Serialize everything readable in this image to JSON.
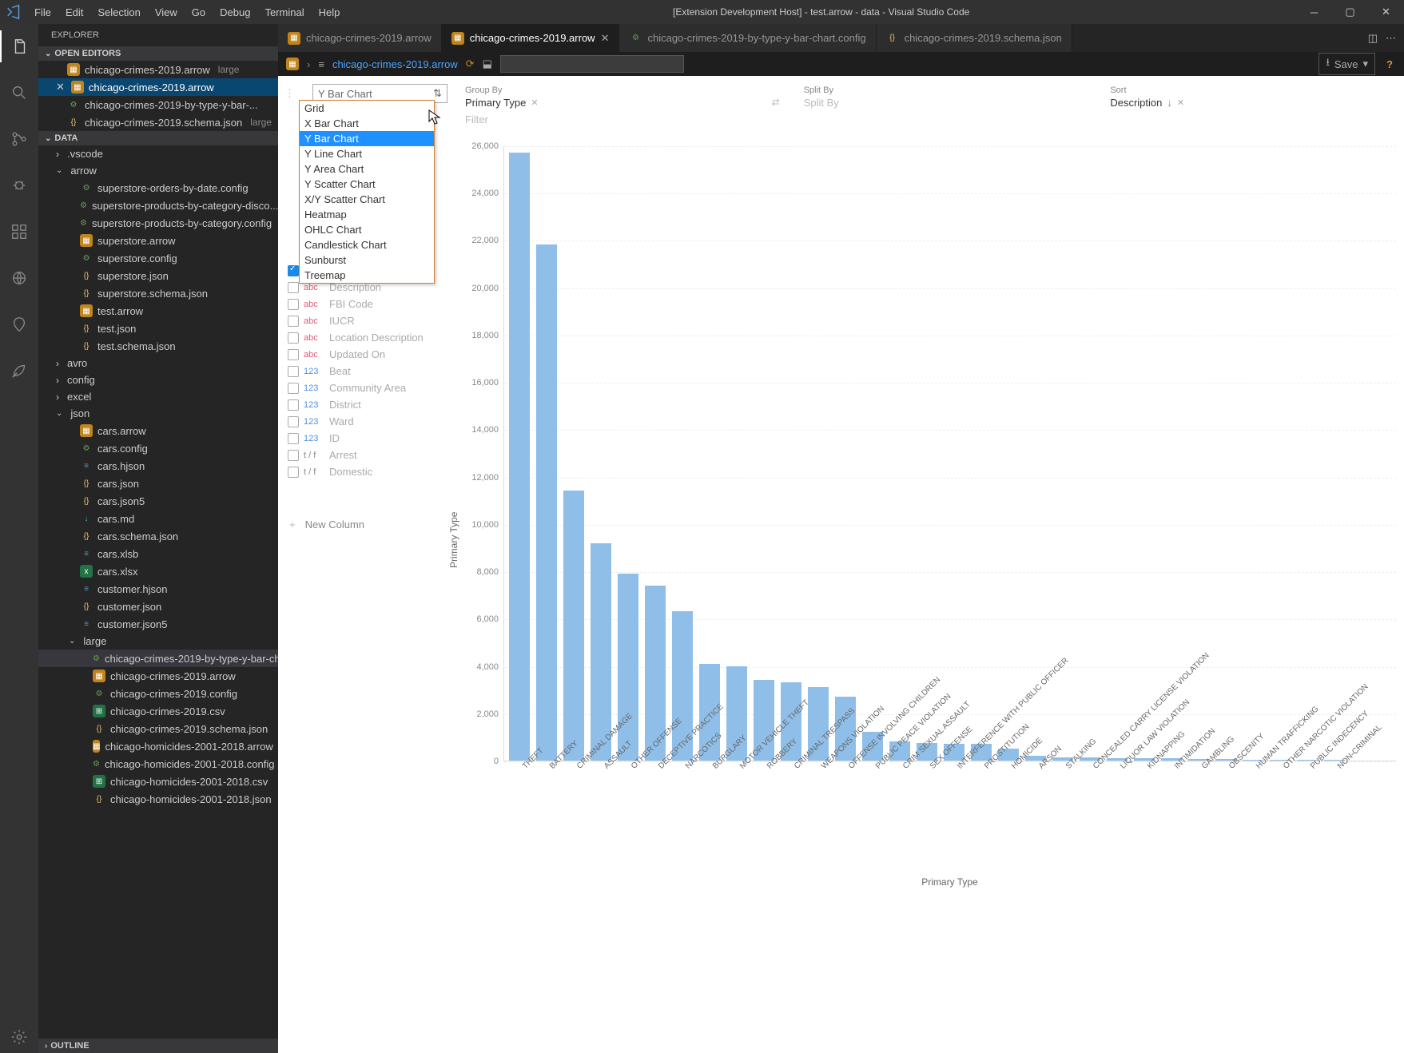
{
  "window": {
    "title": "[Extension Development Host] - test.arrow - data - Visual Studio Code",
    "menus": [
      "File",
      "Edit",
      "Selection",
      "View",
      "Go",
      "Debug",
      "Terminal",
      "Help"
    ]
  },
  "sidebar": {
    "title": "EXPLORER",
    "sections": {
      "open_editors": "OPEN EDITORS",
      "data": "DATA",
      "outline": "OUTLINE"
    },
    "open_editors": [
      {
        "icon": "arrow",
        "name": "chicago-crimes-2019.arrow",
        "suffix": "large"
      },
      {
        "icon": "arrow",
        "name": "chicago-crimes-2019.arrow",
        "active": true,
        "close": true
      },
      {
        "icon": "gear",
        "name": "chicago-crimes-2019-by-type-y-bar-..."
      },
      {
        "icon": "json",
        "name": "chicago-crimes-2019.schema.json",
        "suffix": "large"
      }
    ],
    "tree": [
      {
        "type": "folder",
        "name": ".vscode",
        "indent": 1,
        "closed": true
      },
      {
        "type": "folder",
        "name": "arrow",
        "indent": 1
      },
      {
        "type": "file",
        "icon": "gear",
        "name": "superstore-orders-by-date.config",
        "indent": 2
      },
      {
        "type": "file",
        "icon": "gear",
        "name": "superstore-products-by-category-disco...",
        "indent": 2
      },
      {
        "type": "file",
        "icon": "gear",
        "name": "superstore-products-by-category.config",
        "indent": 2
      },
      {
        "type": "file",
        "icon": "arrow",
        "name": "superstore.arrow",
        "indent": 2
      },
      {
        "type": "file",
        "icon": "gear",
        "name": "superstore.config",
        "indent": 2
      },
      {
        "type": "file",
        "icon": "json",
        "name": "superstore.json",
        "indent": 2
      },
      {
        "type": "file",
        "icon": "json",
        "name": "superstore.schema.json",
        "indent": 2
      },
      {
        "type": "file",
        "icon": "arrow",
        "name": "test.arrow",
        "indent": 2
      },
      {
        "type": "file",
        "icon": "json",
        "name": "test.json",
        "indent": 2
      },
      {
        "type": "file",
        "icon": "json",
        "name": "test.schema.json",
        "indent": 2
      },
      {
        "type": "folder",
        "name": "avro",
        "indent": 1,
        "closed": true
      },
      {
        "type": "folder",
        "name": "config",
        "indent": 1,
        "closed": true
      },
      {
        "type": "folder",
        "name": "excel",
        "indent": 1,
        "closed": true
      },
      {
        "type": "folder",
        "name": "json",
        "indent": 1
      },
      {
        "type": "file",
        "icon": "arrow",
        "name": "cars.arrow",
        "indent": 2
      },
      {
        "type": "file",
        "icon": "gear",
        "name": "cars.config",
        "indent": 2
      },
      {
        "type": "file",
        "icon": "text",
        "name": "cars.hjson",
        "indent": 2
      },
      {
        "type": "file",
        "icon": "json",
        "name": "cars.json",
        "indent": 2
      },
      {
        "type": "file",
        "icon": "json",
        "name": "cars.json5",
        "indent": 2
      },
      {
        "type": "file",
        "icon": "md",
        "name": "cars.md",
        "indent": 2
      },
      {
        "type": "file",
        "icon": "json",
        "name": "cars.schema.json",
        "indent": 2
      },
      {
        "type": "file",
        "icon": "text",
        "name": "cars.xlsb",
        "indent": 2
      },
      {
        "type": "file",
        "icon": "xlsx",
        "name": "cars.xlsx",
        "indent": 2
      },
      {
        "type": "file",
        "icon": "text",
        "name": "customer.hjson",
        "indent": 2
      },
      {
        "type": "file",
        "icon": "json",
        "name": "customer.json",
        "indent": 2
      },
      {
        "type": "file",
        "icon": "text",
        "name": "customer.json5",
        "indent": 2
      },
      {
        "type": "folder",
        "name": "large",
        "indent": 2
      },
      {
        "type": "file",
        "icon": "gear",
        "name": "chicago-crimes-2019-by-type-y-bar-ch...",
        "indent": 3,
        "selected": true
      },
      {
        "type": "file",
        "icon": "arrow",
        "name": "chicago-crimes-2019.arrow",
        "indent": 3
      },
      {
        "type": "file",
        "icon": "gear",
        "name": "chicago-crimes-2019.config",
        "indent": 3
      },
      {
        "type": "file",
        "icon": "csv",
        "name": "chicago-crimes-2019.csv",
        "indent": 3
      },
      {
        "type": "file",
        "icon": "json",
        "name": "chicago-crimes-2019.schema.json",
        "indent": 3
      },
      {
        "type": "file",
        "icon": "arrow",
        "name": "chicago-homicides-2001-2018.arrow",
        "indent": 3
      },
      {
        "type": "file",
        "icon": "gear",
        "name": "chicago-homicides-2001-2018.config",
        "indent": 3
      },
      {
        "type": "file",
        "icon": "csv",
        "name": "chicago-homicides-2001-2018.csv",
        "indent": 3
      },
      {
        "type": "file",
        "icon": "json",
        "name": "chicago-homicides-2001-2018.json",
        "indent": 3
      }
    ]
  },
  "tabs": [
    {
      "icon": "arrow",
      "label": "chicago-crimes-2019.arrow"
    },
    {
      "icon": "arrow",
      "label": "chicago-crimes-2019.arrow",
      "active": true
    },
    {
      "icon": "gear",
      "label": "chicago-crimes-2019-by-type-y-bar-chart.config"
    },
    {
      "icon": "json",
      "label": "chicago-crimes-2019.schema.json"
    }
  ],
  "breadcrumb": {
    "file": "chicago-crimes-2019.arrow",
    "save": "Save"
  },
  "viz": {
    "chartType": "Y Bar Chart",
    "dropdown": [
      "Grid",
      "X Bar Chart",
      "Y Bar Chart",
      "Y Line Chart",
      "Y Area Chart",
      "Y Scatter Chart",
      "X/Y Scatter Chart",
      "Heatmap",
      "OHLC Chart",
      "Candlestick Chart",
      "Sunburst",
      "Treemap"
    ],
    "dropdown_selected": "Y Bar Chart",
    "groupby": {
      "label": "Group By",
      "value": "Primary Type"
    },
    "splitby": {
      "label": "Split By",
      "value": "Split By"
    },
    "sort": {
      "label": "Sort",
      "value": "Description"
    },
    "filter": "Filter",
    "fields": [
      {
        "checked": true,
        "type": "",
        "name": ""
      },
      {
        "checked": false,
        "type": "abc",
        "name": "Description"
      },
      {
        "checked": false,
        "type": "abc",
        "name": "FBI Code"
      },
      {
        "checked": false,
        "type": "abc",
        "name": "IUCR"
      },
      {
        "checked": false,
        "type": "abc",
        "name": "Location Description"
      },
      {
        "checked": false,
        "type": "abc",
        "name": "Updated On"
      },
      {
        "checked": false,
        "type": "123",
        "name": "Beat"
      },
      {
        "checked": false,
        "type": "123",
        "name": "Community Area"
      },
      {
        "checked": false,
        "type": "123",
        "name": "District"
      },
      {
        "checked": false,
        "type": "123",
        "name": "Ward"
      },
      {
        "checked": false,
        "type": "123",
        "name": "ID"
      },
      {
        "checked": false,
        "type": "t/f",
        "name": "Arrest"
      },
      {
        "checked": false,
        "type": "t/f",
        "name": "Domestic"
      }
    ],
    "newcol": "New Column"
  },
  "chart_data": {
    "type": "bar",
    "title": "",
    "xlabel": "Primary Type",
    "ylabel": "Primary Type",
    "ylim": [
      0,
      26000
    ],
    "yticks": [
      0,
      2000,
      4000,
      6000,
      8000,
      10000,
      12000,
      14000,
      16000,
      18000,
      20000,
      22000,
      24000,
      26000
    ],
    "categories": [
      "THEFT",
      "BATTERY",
      "CRIMINAL DAMAGE",
      "ASSAULT",
      "OTHER OFFENSE",
      "DECEPTIVE PRACTICE",
      "NARCOTICS",
      "BURGLARY",
      "MOTOR VEHICLE THEFT",
      "ROBBERY",
      "CRIMINAL TRESPASS",
      "WEAPONS VIOLATION",
      "OFFENSE INVOLVING CHILDREN",
      "PUBLIC PEACE VIOLATION",
      "CRIM SEXUAL ASSAULT",
      "SEX OFFENSE",
      "INTERFERENCE WITH PUBLIC OFFICER",
      "PROSTITUTION",
      "HOMICIDE",
      "ARSON",
      "STALKING",
      "CONCEALED CARRY LICENSE VIOLATION",
      "LIQUOR LAW VIOLATION",
      "KIDNAPPING",
      "INTIMIDATION",
      "GAMBLING",
      "OBSCENITY",
      "HUMAN TRAFFICKING",
      "OTHER NARCOTIC VIOLATION",
      "PUBLIC INDECENCY",
      "NON-CRIMINAL"
    ],
    "values": [
      25700,
      21800,
      11400,
      9200,
      7900,
      7400,
      6300,
      4100,
      4000,
      3400,
      3300,
      3100,
      2700,
      1200,
      800,
      750,
      720,
      700,
      500,
      200,
      150,
      120,
      110,
      100,
      90,
      80,
      60,
      40,
      30,
      25,
      20
    ]
  }
}
